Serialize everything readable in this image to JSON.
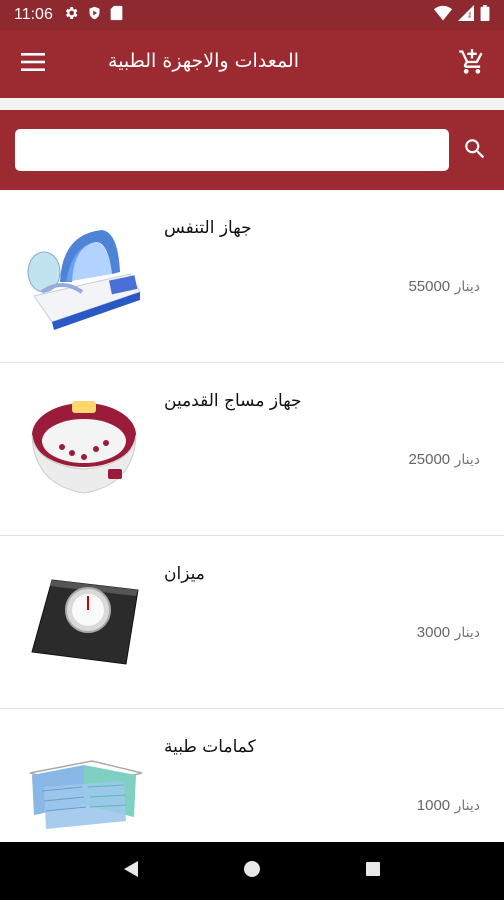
{
  "status_bar": {
    "time": "11:06",
    "left_icons": [
      "gear-icon",
      "shield-play-icon",
      "sd-card-icon"
    ],
    "right_icons": [
      "wifi-icon",
      "signal-icon",
      "battery-icon"
    ]
  },
  "app_bar": {
    "title": "المعدات والاجهزة الطبية",
    "menu_icon": "hamburger-icon",
    "cart_icon": "add-to-cart-icon"
  },
  "search": {
    "value": "",
    "placeholder": "",
    "icon": "search-icon"
  },
  "colors": {
    "primary": "#9c2b31",
    "primary_dark": "#8e2a2f",
    "price_text": "#777777"
  },
  "products": [
    {
      "name": "جهاز التنفس",
      "price": "55000",
      "currency": "دينار",
      "image": "nebulizer-image"
    },
    {
      "name": "جهاز مساج القدمين",
      "price": "25000",
      "currency": "دينار",
      "image": "foot-massager-image"
    },
    {
      "name": "ميزان",
      "price": "3000",
      "currency": "دينار",
      "image": "scale-image"
    },
    {
      "name": "كمامات طبية",
      "price": "1000",
      "currency": "دينار",
      "image": "face-masks-image"
    }
  ],
  "nav_bar": {
    "buttons": [
      "back-icon",
      "home-icon",
      "recents-icon"
    ]
  }
}
